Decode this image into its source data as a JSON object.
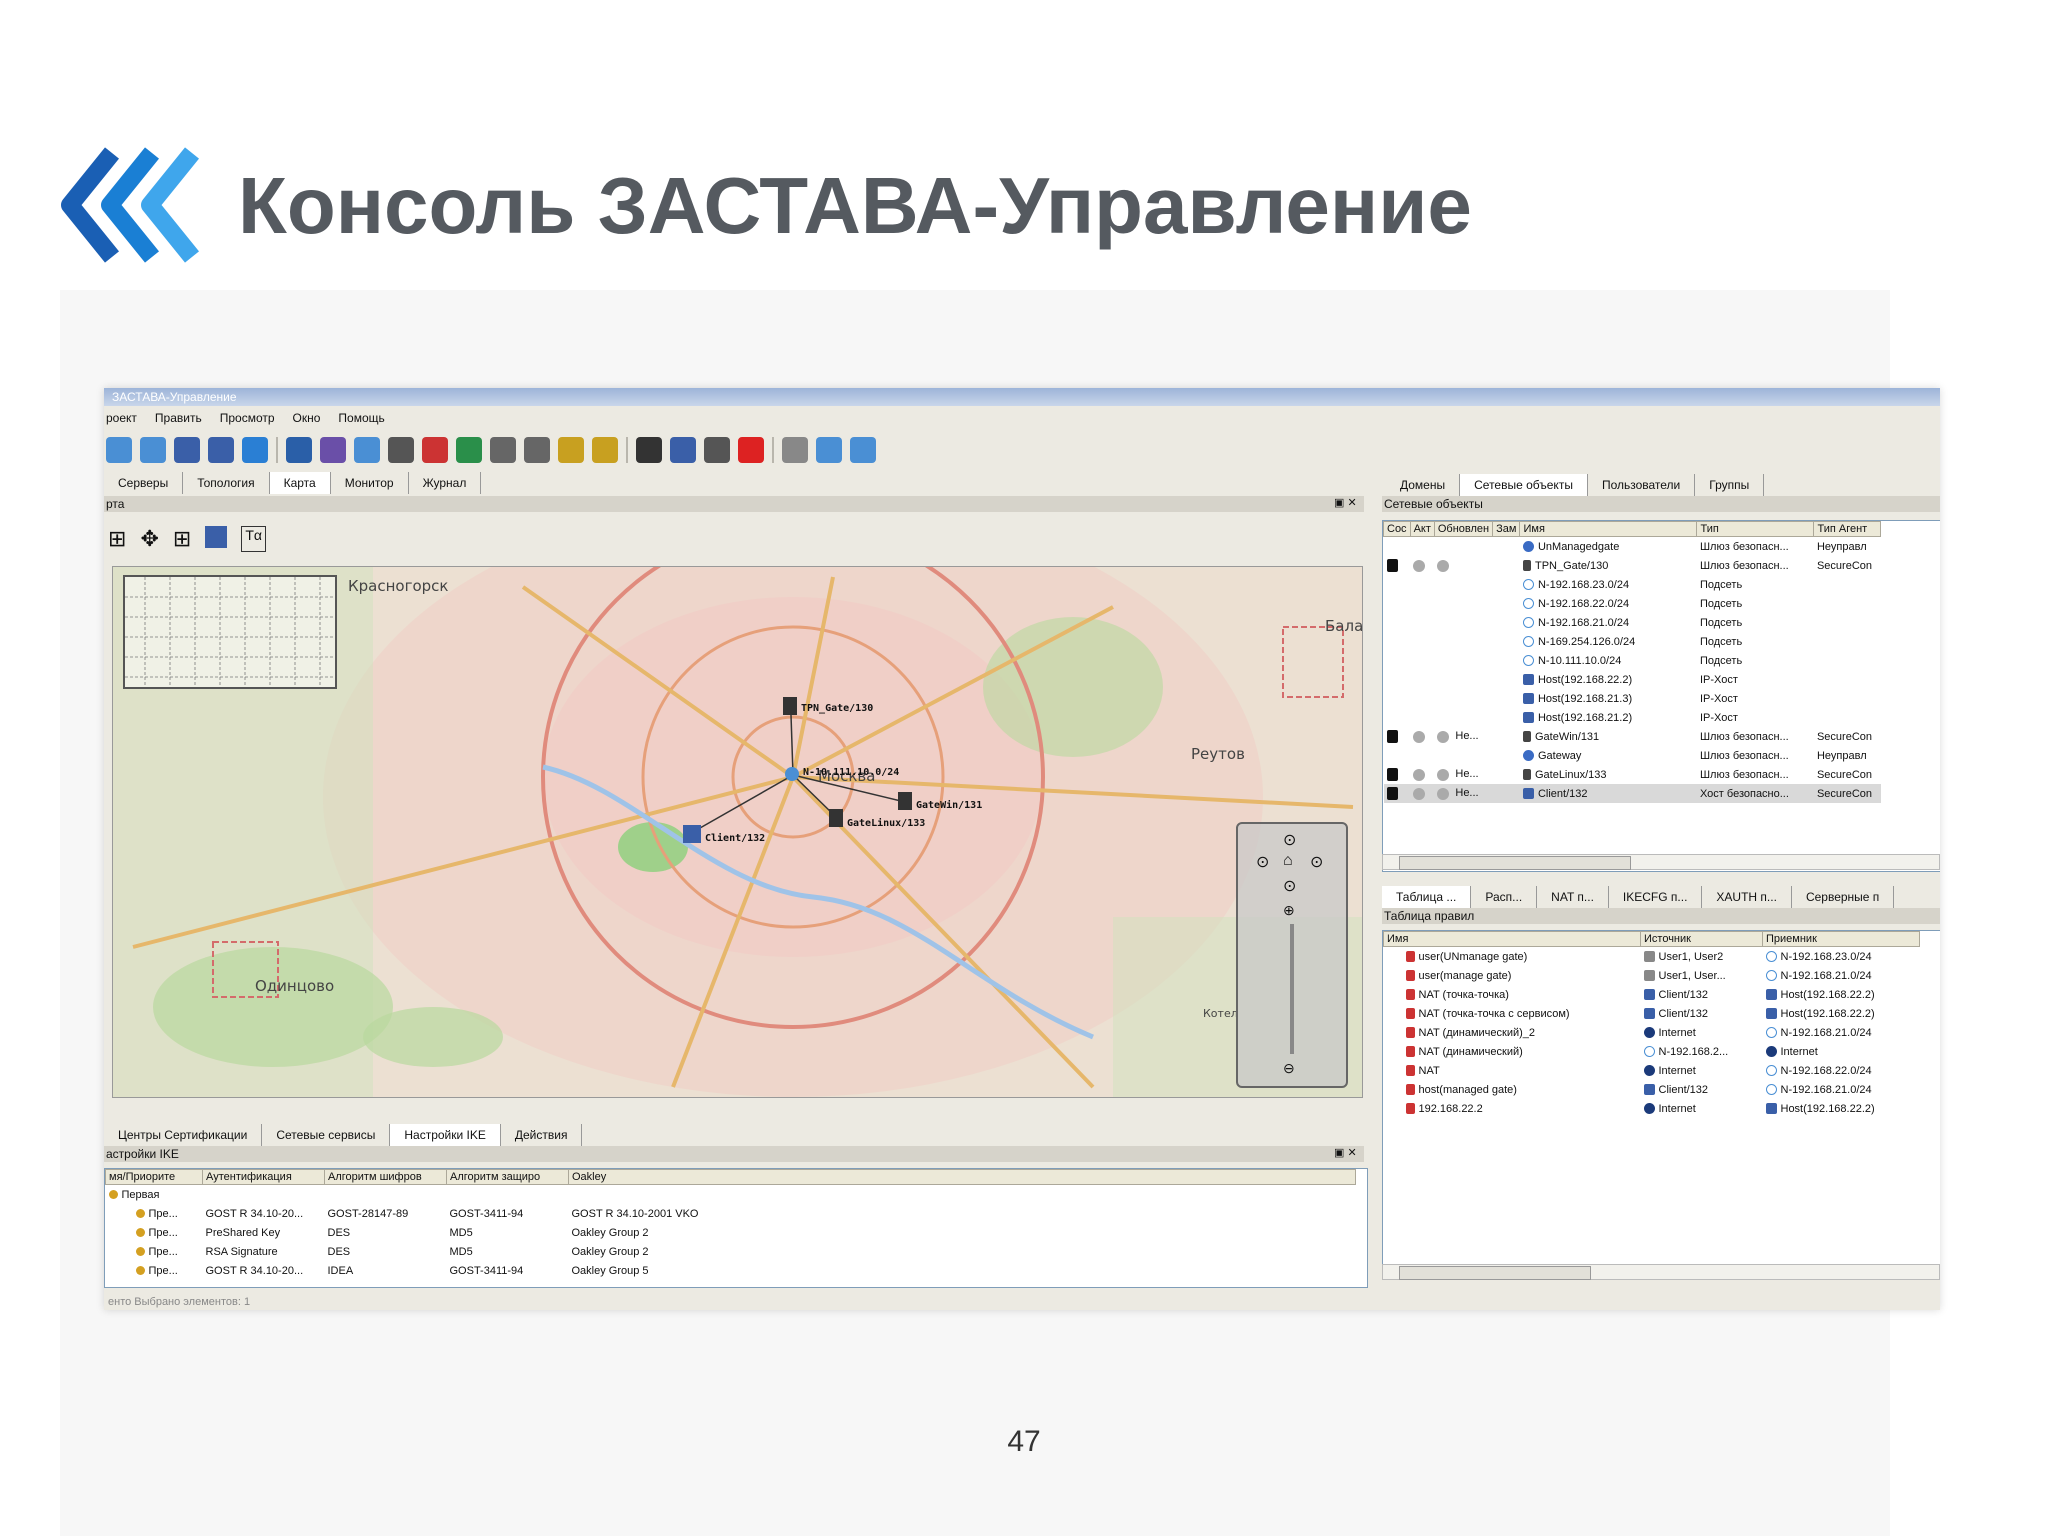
{
  "slide": {
    "title": "Консоль ЗАСТАВА-Управление",
    "page_number": "47"
  },
  "colors": {
    "accent": "#1a7fd4",
    "title": "#555a60"
  },
  "app": {
    "window_title": "ЗАСТАВА-Управление",
    "menu": [
      "роект",
      "Править",
      "Просмотр",
      "Окно",
      "Помощь"
    ],
    "toolbar_icons": [
      "connect-icon",
      "disconnect-icon",
      "computer-icon",
      "computer-list-icon",
      "globe-icon",
      "info-icon",
      "users-icon",
      "network-icon",
      "certificate-icon",
      "window-icon",
      "earth-icon",
      "chart-icon",
      "list-icon",
      "key-left-icon",
      "key-right-icon",
      "binoculars-icon",
      "monitor-icon",
      "settings-icon",
      "delete-icon",
      "properties-icon",
      "export-icon",
      "import-icon"
    ],
    "left_tabs": [
      "Серверы",
      "Топология",
      "Карта",
      "Монитор",
      "Журнал"
    ],
    "left_tabs_active": "Карта",
    "map_pane_title": "рта",
    "map": {
      "places": [
        "Красногорск",
        "Москва",
        "Реутов",
        "Одинцово",
        "Бала",
        "Котел"
      ],
      "nodes": [
        "TPN_Gate/130",
        "N-10.111.10.0/24",
        "GateWin/131",
        "GateLinux/133",
        "Client/132"
      ]
    },
    "bottom_tabs": [
      "Центры Сертификации",
      "Сетевые сервисы",
      "Настройки IKE",
      "Действия"
    ],
    "bottom_tabs_active": "Настройки IKE",
    "ike_pane_title": "астройки IKE",
    "ike": {
      "columns": [
        "мя/Приорите",
        "Аутентификация",
        "Алгоритм шифров",
        "Алгоритм защиро",
        "Oakley"
      ],
      "group": "Первая",
      "rows": [
        [
          "Пре...",
          "GOST R 34.10-20...",
          "GOST-28147-89",
          "GOST-3411-94",
          "GOST R 34.10-2001 VKO"
        ],
        [
          "Пре...",
          "PreShared Key",
          "DES",
          "MD5",
          "Oakley Group 2"
        ],
        [
          "Пре...",
          "RSA Signature",
          "DES",
          "MD5",
          "Oakley Group 2"
        ],
        [
          "Пре...",
          "GOST R 34.10-20...",
          "IDEA",
          "GOST-3411-94",
          "Oakley Group 5"
        ]
      ]
    },
    "status_text": "енто Выбрано элементов: 1",
    "right_tabs": [
      "Домены",
      "Сетевые объекты",
      "Пользователи",
      "Группы"
    ],
    "right_tabs_active": "Сетевые объекты",
    "objects_pane_title": "Сетевые объекты",
    "objects": {
      "columns": [
        "Сос",
        "Акт",
        "Обновлен",
        "Зам",
        "Имя",
        "Тип",
        "Тип Агент"
      ],
      "rows": [
        {
          "lock": false,
          "dots": false,
          "upd": "",
          "icon": "um",
          "name": "UnManagedgate",
          "type": "Шлюз безопасн...",
          "agent": "Неуправл"
        },
        {
          "lock": true,
          "dots": true,
          "upd": "",
          "icon": "gate",
          "name": "TPN_Gate/130",
          "type": "Шлюз безопасн...",
          "agent": "SecureCon"
        },
        {
          "lock": false,
          "dots": false,
          "upd": "",
          "icon": "subnet",
          "name": "N-192.168.23.0/24",
          "type": "Подсеть",
          "agent": ""
        },
        {
          "lock": false,
          "dots": false,
          "upd": "",
          "icon": "subnet",
          "name": "N-192.168.22.0/24",
          "type": "Подсеть",
          "agent": ""
        },
        {
          "lock": false,
          "dots": false,
          "upd": "",
          "icon": "subnet",
          "name": "N-192.168.21.0/24",
          "type": "Подсеть",
          "agent": ""
        },
        {
          "lock": false,
          "dots": false,
          "upd": "",
          "icon": "subnet",
          "name": "N-169.254.126.0/24",
          "type": "Подсеть",
          "agent": ""
        },
        {
          "lock": false,
          "dots": false,
          "upd": "",
          "icon": "subnet",
          "name": "N-10.111.10.0/24",
          "type": "Подсеть",
          "agent": ""
        },
        {
          "lock": false,
          "dots": false,
          "upd": "",
          "icon": "host",
          "name": "Host(192.168.22.2)",
          "type": "IP-Хост",
          "agent": ""
        },
        {
          "lock": false,
          "dots": false,
          "upd": "",
          "icon": "host",
          "name": "Host(192.168.21.3)",
          "type": "IP-Хост",
          "agent": ""
        },
        {
          "lock": false,
          "dots": false,
          "upd": "",
          "icon": "host",
          "name": "Host(192.168.21.2)",
          "type": "IP-Хост",
          "agent": ""
        },
        {
          "lock": true,
          "dots": true,
          "upd": "Не...",
          "icon": "gate",
          "name": "GateWin/131",
          "type": "Шлюз безопасн...",
          "agent": "SecureCon"
        },
        {
          "lock": false,
          "dots": false,
          "upd": "",
          "icon": "um",
          "name": "Gateway",
          "type": "Шлюз безопасн...",
          "agent": "Неуправл"
        },
        {
          "lock": true,
          "dots": true,
          "upd": "Не...",
          "icon": "gate",
          "name": "GateLinux/133",
          "type": "Шлюз безопасн...",
          "agent": "SecureCon"
        },
        {
          "lock": true,
          "dots": true,
          "upd": "Не...",
          "icon": "host",
          "name": "Client/132",
          "type": "Хост безопасно...",
          "agent": "SecureCon"
        }
      ]
    },
    "rules_tabs": [
      "Таблица ...",
      "Расп...",
      "NAT п...",
      "IKECFG п...",
      "XAUTH п...",
      "Серверные п"
    ],
    "rules_tabs_active": "Таблица ...",
    "rules_pane_title": "Таблица правил",
    "rules": {
      "columns": [
        "Имя",
        "Источник",
        "Приемник"
      ],
      "rows": [
        {
          "name": "user(UNmanage gate)",
          "src_icon": "user",
          "src": "User1, User2",
          "dst_icon": "subnet",
          "dst": "N-192.168.23.0/24"
        },
        {
          "name": "user(manage gate)",
          "src_icon": "user",
          "src": "User1, User...",
          "dst_icon": "subnet",
          "dst": "N-192.168.21.0/24"
        },
        {
          "name": "NAT (точка-точка)",
          "src_icon": "host",
          "src": "Client/132",
          "dst_icon": "host",
          "dst": "Host(192.168.22.2)"
        },
        {
          "name": "NAT (точка-точка с сервисом)",
          "src_icon": "host",
          "src": "Client/132",
          "dst_icon": "host",
          "dst": "Host(192.168.22.2)"
        },
        {
          "name": "NAT (динамический)_2",
          "src_icon": "net",
          "src": "Internet",
          "dst_icon": "subnet",
          "dst": "N-192.168.21.0/24"
        },
        {
          "name": "NAT (динамический)",
          "src_icon": "subnet",
          "src": "N-192.168.2...",
          "dst_icon": "net",
          "dst": "Internet"
        },
        {
          "name": "NAT",
          "src_icon": "net",
          "src": "Internet",
          "dst_icon": "subnet",
          "dst": "N-192.168.22.0/24"
        },
        {
          "name": "host(managed gate)",
          "src_icon": "host",
          "src": "Client/132",
          "dst_icon": "subnet",
          "dst": "N-192.168.21.0/24"
        },
        {
          "name": "192.168.22.2",
          "src_icon": "net",
          "src": "Internet",
          "dst_icon": "host",
          "dst": "Host(192.168.22.2)"
        }
      ]
    }
  }
}
